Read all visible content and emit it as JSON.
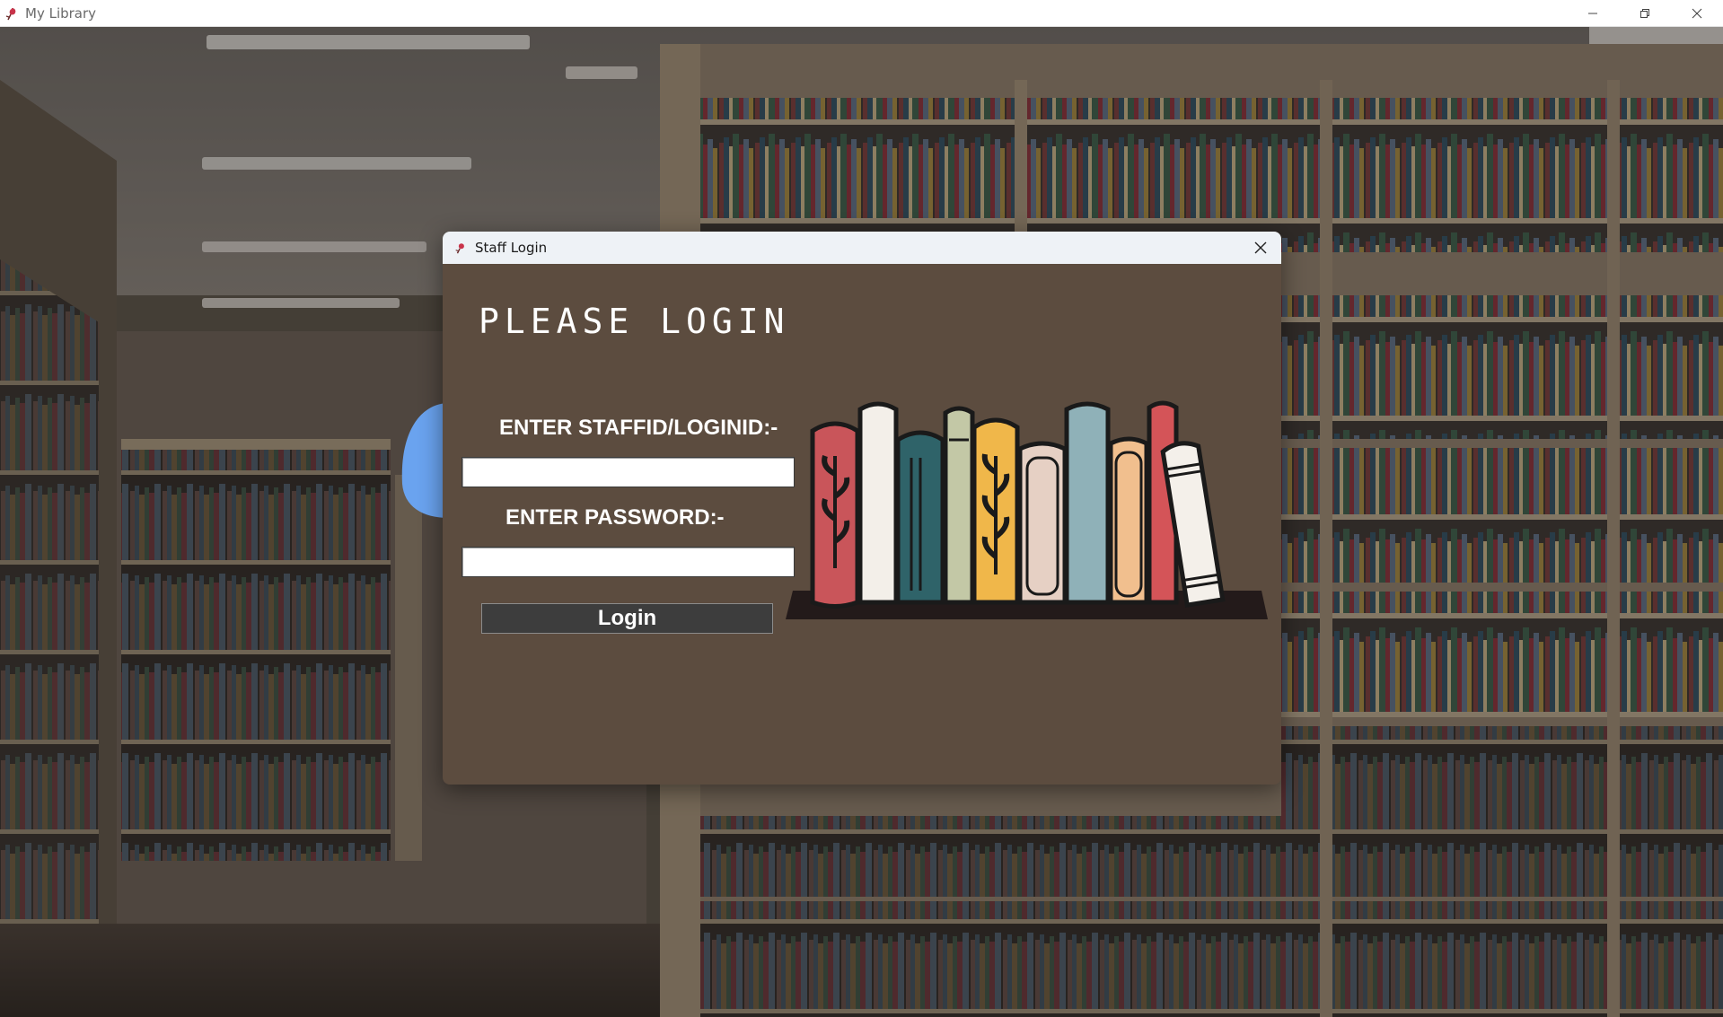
{
  "window": {
    "title": "My Library",
    "icon": "rose-icon"
  },
  "dialog": {
    "title": "Staff Login",
    "heading": "PLEASE LOGIN",
    "staff_label": "ENTER STAFFID/LOGINID:-",
    "staff_value": "",
    "password_label": "ENTER PASSWORD:-",
    "password_value": "",
    "login_label": "Login"
  },
  "colors": {
    "dialog_bg": "#5c4c3f",
    "button_bg": "#3d3d3d",
    "shelf": "#231a1a"
  }
}
